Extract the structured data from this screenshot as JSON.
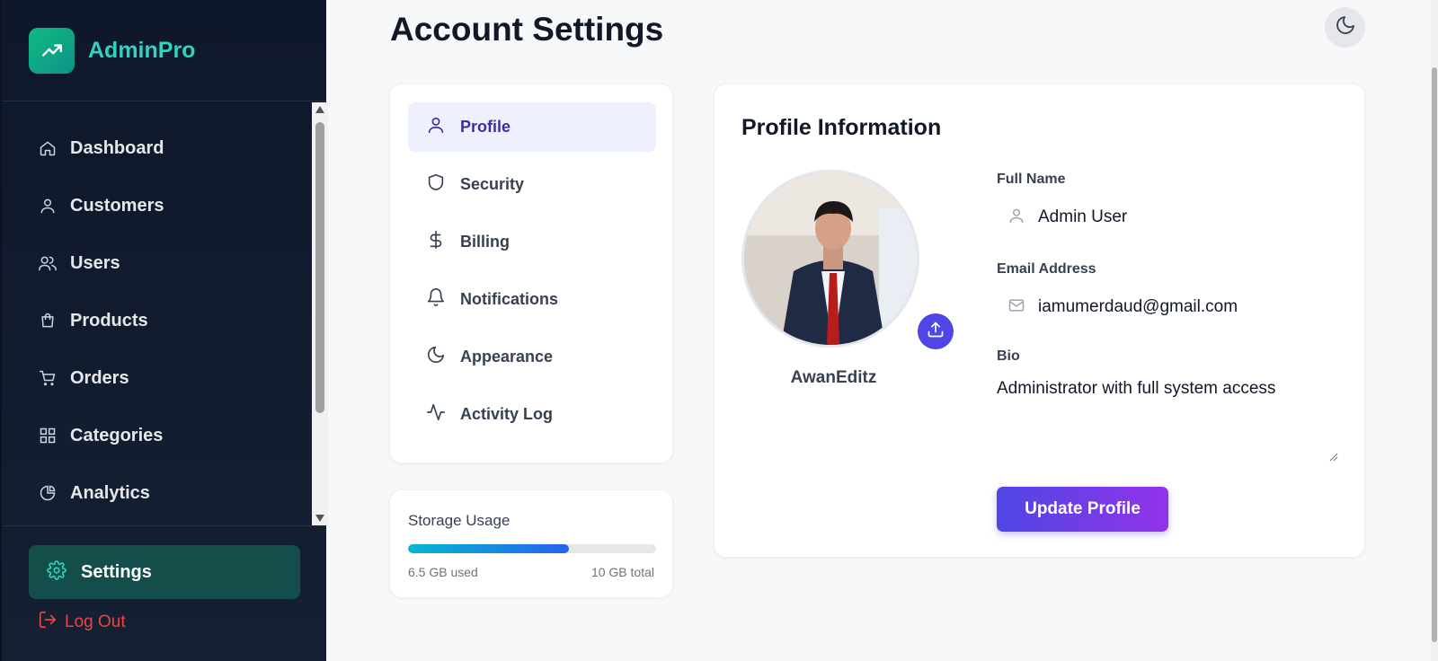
{
  "app": {
    "name": "AdminPro"
  },
  "sidebar": {
    "items": [
      {
        "label": "Dashboard",
        "icon": "home-icon"
      },
      {
        "label": "Customers",
        "icon": "user-icon"
      },
      {
        "label": "Users",
        "icon": "users-icon"
      },
      {
        "label": "Products",
        "icon": "shopping-bag-icon"
      },
      {
        "label": "Orders",
        "icon": "cart-icon"
      },
      {
        "label": "Categories",
        "icon": "grid-icon"
      },
      {
        "label": "Analytics",
        "icon": "pie-chart-icon"
      }
    ],
    "settings_label": "Settings",
    "logout_label": "Log Out"
  },
  "page": {
    "title": "Account Settings"
  },
  "tabs": [
    {
      "label": "Profile",
      "icon": "user-icon",
      "active": true
    },
    {
      "label": "Security",
      "icon": "shield-icon",
      "active": false
    },
    {
      "label": "Billing",
      "icon": "dollar-icon",
      "active": false
    },
    {
      "label": "Notifications",
      "icon": "bell-icon",
      "active": false
    },
    {
      "label": "Appearance",
      "icon": "moon-icon",
      "active": false
    },
    {
      "label": "Activity Log",
      "icon": "activity-icon",
      "active": false
    }
  ],
  "storage": {
    "title": "Storage Usage",
    "used_label": "6.5 GB used",
    "total_label": "10 GB total",
    "used_fraction": 0.65
  },
  "profile": {
    "heading": "Profile Information",
    "username": "AwanEditz",
    "full_name_label": "Full Name",
    "full_name": "Admin User",
    "email_label": "Email Address",
    "email": "iamumerdaud@gmail.com",
    "bio_label": "Bio",
    "bio": "Administrator with full system access",
    "update_button": "Update Profile"
  },
  "colors": {
    "accent": "#4f46e5",
    "brand": "#2dd4bf",
    "sidebar_bg": "#0f172a",
    "logout": "#ef4444"
  }
}
